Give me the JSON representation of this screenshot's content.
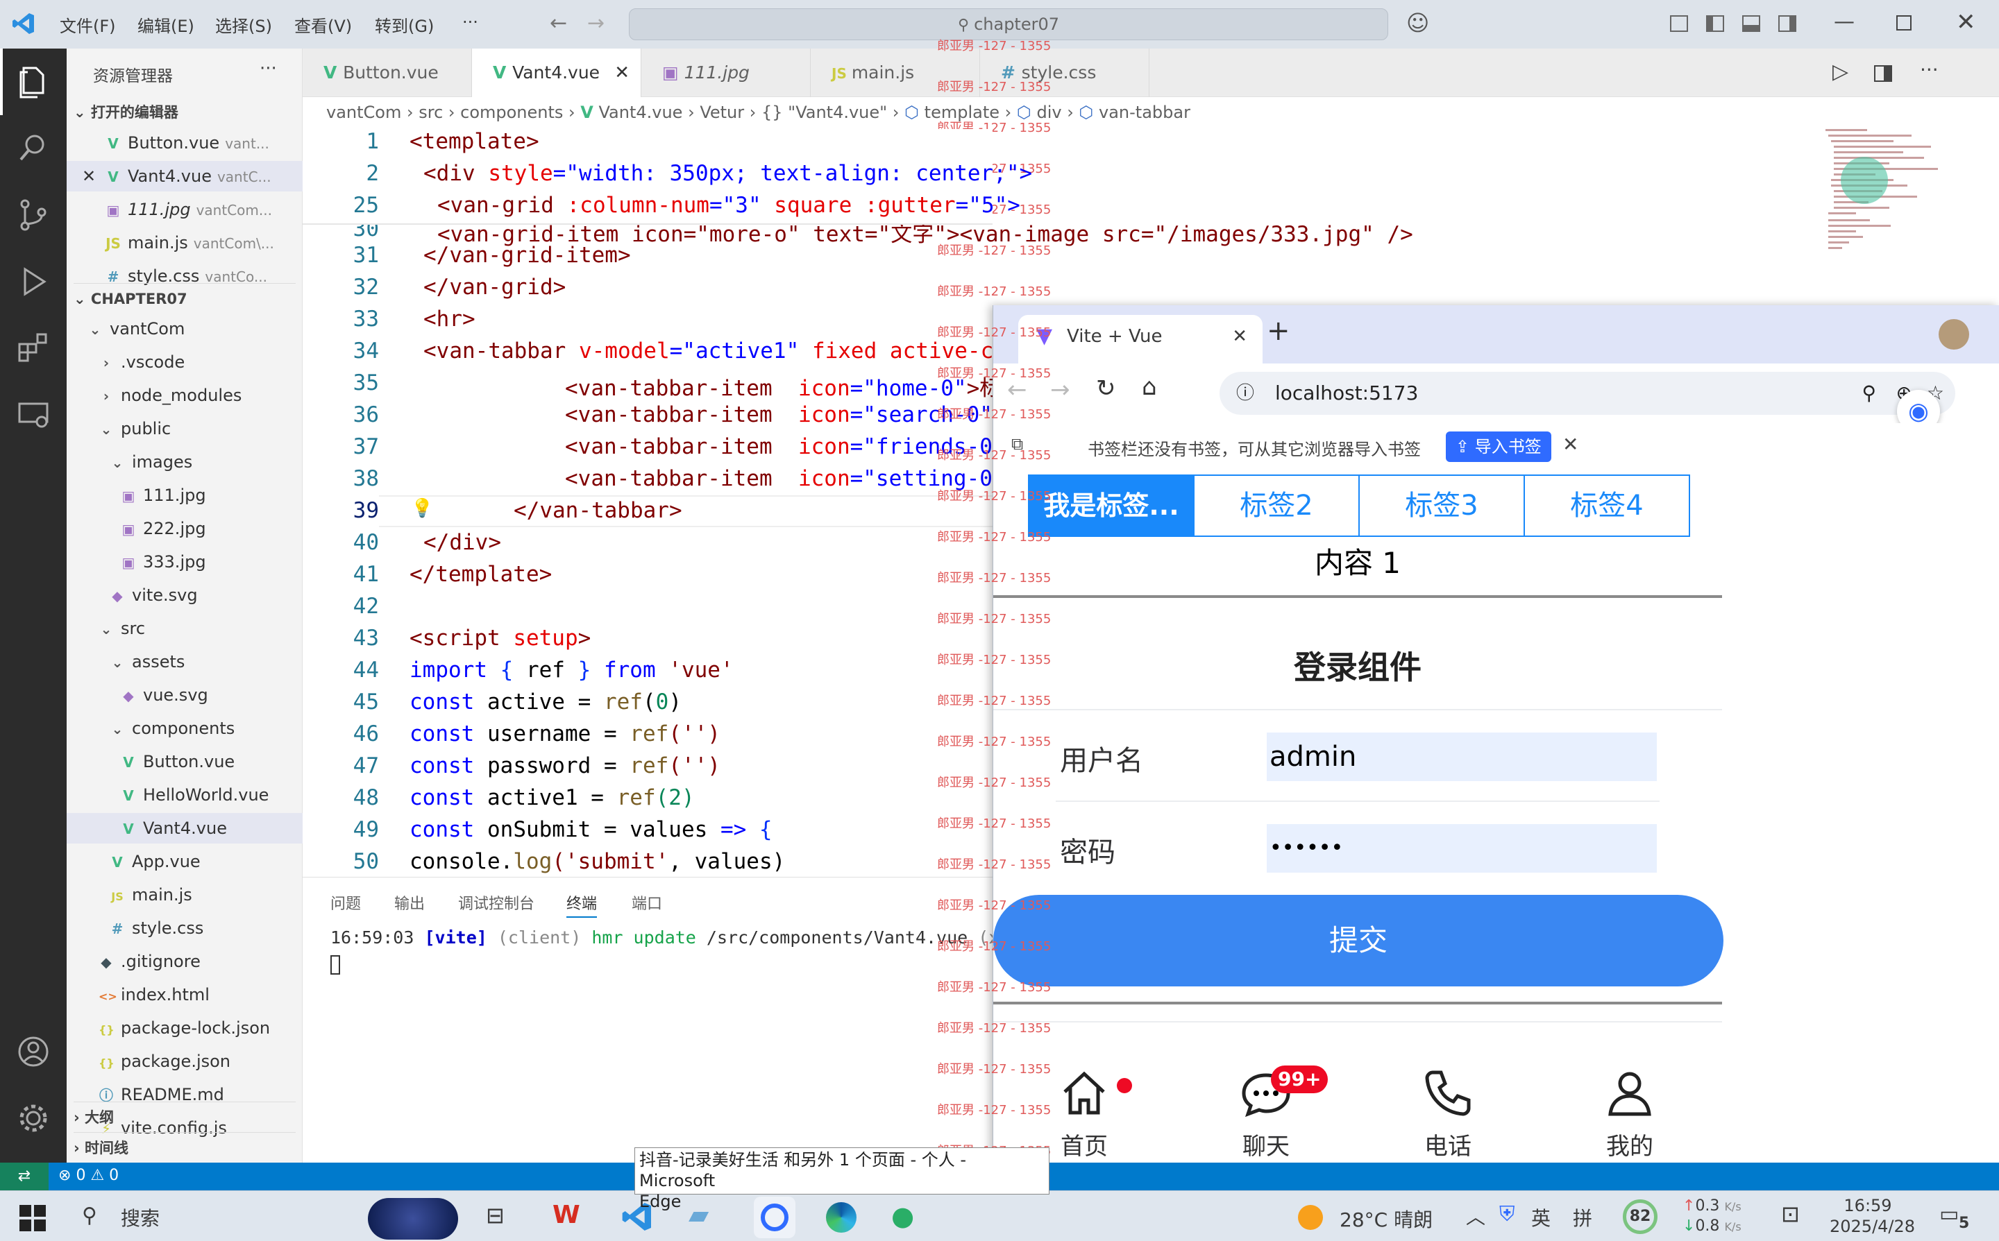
{
  "titlebar": {
    "menus": [
      "文件(F)",
      "编辑(E)",
      "选择(S)",
      "查看(V)",
      "转到(G)",
      "···"
    ],
    "search": "chapter07"
  },
  "sidebar": {
    "title": "资源管理器",
    "more": "···",
    "open_editors_header": "打开的编辑器",
    "open_editors": [
      {
        "name": "Button.vue",
        "hint": "vant...",
        "icon": "vue-icon"
      },
      {
        "name": "Vant4.vue",
        "hint": "vantC...",
        "icon": "vue-icon"
      },
      {
        "name": "111.jpg",
        "hint": "vantCom...",
        "icon": "image-icon"
      },
      {
        "name": "main.js",
        "hint": "vantCom\\...",
        "icon": "js-icon"
      },
      {
        "name": "style.css",
        "hint": "vantCo...",
        "icon": "css-icon"
      }
    ],
    "project_header": "CHAPTER07",
    "tree": [
      {
        "name": "vantCom",
        "indent": 0,
        "kind": "folder-open"
      },
      {
        "name": ".vscode",
        "indent": 1,
        "kind": "folder"
      },
      {
        "name": "node_modules",
        "indent": 1,
        "kind": "folder"
      },
      {
        "name": "public",
        "indent": 1,
        "kind": "folder-open"
      },
      {
        "name": "images",
        "indent": 2,
        "kind": "folder-open"
      },
      {
        "name": "111.jpg",
        "indent": 3,
        "kind": "image"
      },
      {
        "name": "222.jpg",
        "indent": 3,
        "kind": "image"
      },
      {
        "name": "333.jpg",
        "indent": 3,
        "kind": "image"
      },
      {
        "name": "vite.svg",
        "indent": 2,
        "kind": "svg"
      },
      {
        "name": "src",
        "indent": 1,
        "kind": "folder-open"
      },
      {
        "name": "assets",
        "indent": 2,
        "kind": "folder-open"
      },
      {
        "name": "vue.svg",
        "indent": 3,
        "kind": "svg"
      },
      {
        "name": "components",
        "indent": 2,
        "kind": "folder-open"
      },
      {
        "name": "Button.vue",
        "indent": 3,
        "kind": "vue"
      },
      {
        "name": "HelloWorld.vue",
        "indent": 3,
        "kind": "vue"
      },
      {
        "name": "Vant4.vue",
        "indent": 3,
        "kind": "vue",
        "selected": true
      },
      {
        "name": "App.vue",
        "indent": 2,
        "kind": "vue"
      },
      {
        "name": "main.js",
        "indent": 2,
        "kind": "js"
      },
      {
        "name": "style.css",
        "indent": 2,
        "kind": "css"
      },
      {
        "name": ".gitignore",
        "indent": 1,
        "kind": "git"
      },
      {
        "name": "index.html",
        "indent": 1,
        "kind": "html"
      },
      {
        "name": "package-lock.json",
        "indent": 1,
        "kind": "json"
      },
      {
        "name": "package.json",
        "indent": 1,
        "kind": "json"
      },
      {
        "name": "README.md",
        "indent": 1,
        "kind": "info"
      },
      {
        "name": "vite.config.js",
        "indent": 1,
        "kind": "vite"
      }
    ],
    "outline": "大纲",
    "timeline": "时间线"
  },
  "tabs": [
    {
      "label": "Button.vue",
      "icon": "vue-icon"
    },
    {
      "label": "Vant4.vue",
      "icon": "vue-icon",
      "active": true
    },
    {
      "label": "111.jpg",
      "icon": "image-icon"
    },
    {
      "label": "main.js",
      "icon": "js-icon"
    },
    {
      "label": "style.css",
      "icon": "css-icon"
    }
  ],
  "breadcrumb": [
    "vantCom",
    "src",
    "components",
    "Vant4.vue",
    "Vetur",
    "{} \"Vant4.vue\"",
    "template",
    "div",
    "van-tabbar"
  ],
  "code": {
    "line_numbers": [
      "1",
      "2",
      "25",
      "30",
      "31",
      "32",
      "33",
      "34",
      "35",
      "36",
      "37",
      "38",
      "39",
      "40",
      "41",
      "42",
      "43",
      "44",
      "45",
      "46",
      "47",
      "48",
      "49",
      "50"
    ],
    "sticky_1": "<template>",
    "sticky_2_a": "<div ",
    "sticky_2_b": "style",
    "sticky_2_c": "=\"width: 350px; text-align: center;\">",
    "sticky_3_a": "<van-grid ",
    "sticky_3_b": ":column-num",
    "sticky_3_c": "=\"3\" ",
    "sticky_3_d": "square :gutter",
    "sticky_3_e": "=\"5\">",
    "l30": "<van-grid-item icon=\"more-o\" text=\"文字\"><van-image src=\"/images/333.jpg\" />",
    "l31": "</van-grid-item>",
    "l32": "</van-grid>",
    "l33": "<hr>",
    "l34_a": "<van-tabbar ",
    "l34_b": "v-model",
    "l34_c": "=\"active1\" ",
    "l34_d": "fixed active-c",
    "l35_a": "<van-tabbar-item  ",
    "l35_b": "icon",
    "l35_c": "=\"home-0\"",
    "l35_d": ">标",
    "l36_a": "<van-tabbar-item  ",
    "l36_b": "icon",
    "l36_c": "=\"search-0\"",
    "l37_a": "<van-tabbar-item  ",
    "l37_b": "icon",
    "l37_c": "=\"friends-0",
    "l38_a": "<van-tabbar-item  ",
    "l38_b": "icon",
    "l38_c": "=\"setting-0",
    "l39": "</van-tabbar>",
    "l40": "</div>",
    "l41": "</template>",
    "l43_a": "<script ",
    "l43_b": "setup",
    "l43_c": ">",
    "l44_a": "import",
    "l44_b": " { ",
    "l44_c": "ref",
    "l44_d": " } ",
    "l44_e": "from",
    "l44_f": " 'vue'",
    "l45_a": "const",
    "l45_b": " active = ",
    "l45_c": "ref",
    "l45_d": "(",
    "l45_e": "0",
    "l45_f": ")",
    "l46_a": "const",
    "l46_b": " username = ",
    "l46_c": "ref",
    "l46_d": "('')",
    "l47_a": "const",
    "l47_b": " password = ",
    "l47_c": "ref",
    "l47_d": "('')",
    "l48_a": "const",
    "l48_b": " active1 = ",
    "l48_c": "ref",
    "l48_d": "(2)",
    "l49_a": "const",
    "l49_b": " onSubmit = values ",
    "l49_c": "=>",
    "l49_d": " {",
    "l50_a": "console.",
    "l50_b": "log",
    "l50_c": "('submit'",
    "l50_d": ", values)"
  },
  "panel": {
    "tabs": [
      "问题",
      "输出",
      "调试控制台",
      "终端",
      "端口"
    ],
    "active_tab": "终端",
    "terminal_time": "16:59:03",
    "terminal_vite": "[vite]",
    "terminal_client": "(client)",
    "terminal_hmr": "hmr update",
    "terminal_path": "/src/components/Vant4.vue",
    "terminal_tail": "(x"
  },
  "statusbar": {
    "remote": "⇄",
    "errors": "0",
    "warnings": "0"
  },
  "browser": {
    "tab_title": "Vite + Vue",
    "new_tab": "+",
    "url": "localhost:5173",
    "favbar_text": "书签栏还没有书签，可从其它浏览器导入书签",
    "import_button": "导入书签",
    "tabs": [
      "我是标签...",
      "标签2",
      "标签3",
      "标签4"
    ],
    "tab_content": "内容 1",
    "login_title": "登录组件",
    "username_label": "用户名",
    "username_value": "admin",
    "password_label": "密码",
    "password_value": "••••••",
    "submit": "提交",
    "tabbar": [
      {
        "label": "首页",
        "icon": "home-icon"
      },
      {
        "label": "聊天",
        "icon": "chat-icon",
        "badge": "99+"
      },
      {
        "label": "电话",
        "icon": "phone-icon"
      },
      {
        "label": "我的",
        "icon": "user-icon"
      }
    ]
  },
  "tooltip": {
    "line1": "抖音-记录美好生活 和另外 1 个页面 - 个人 - Microsoft",
    "line2": "Edge"
  },
  "watermark": "郎亚男 -127 - 1355",
  "taskbar": {
    "search": "搜索",
    "weather": "28°C  晴朗",
    "ime": "英",
    "ime2": "拼",
    "battery": "82",
    "net_up": "0.3",
    "net_down": "0.8",
    "net_unit": "K/s",
    "time": "16:59",
    "date": "2025/4/28",
    "notifications": "5"
  },
  "colors": {
    "accent": "#007acc",
    "vant_blue": "#1989fa",
    "submit_blue": "#3a87f2",
    "badge_red": "#ee0a24"
  }
}
